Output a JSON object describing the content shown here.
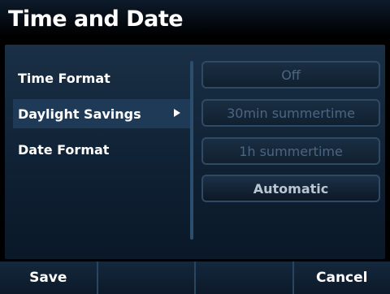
{
  "title": "Time and Date",
  "menu": [
    {
      "label": "Time Format"
    },
    {
      "label": "Daylight Savings",
      "selected": true
    },
    {
      "label": "Date Format"
    }
  ],
  "options": [
    {
      "label": "Off",
      "enabled": false
    },
    {
      "label": "30min summertime",
      "enabled": false
    },
    {
      "label": "1h summertime",
      "enabled": false
    },
    {
      "label": "Automatic",
      "enabled": true
    }
  ],
  "softkeys": [
    "Save",
    "",
    "",
    "Cancel"
  ],
  "colors": {
    "background": "#000000",
    "panel": "#13263a",
    "selected_row": "#1f3a56",
    "divider": "#2c4e6e",
    "text": "#ffffff",
    "disabled_text": "#4b6680"
  }
}
